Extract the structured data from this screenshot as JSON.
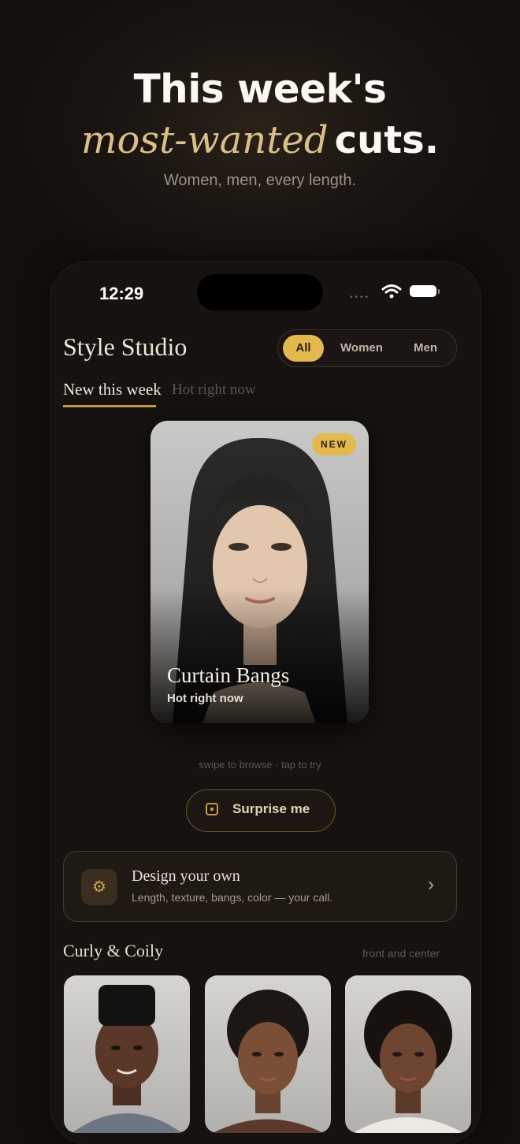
{
  "hero": {
    "line1": "This week's",
    "italic": "most-wanted",
    "bold": "cuts.",
    "subtitle": "Women, men, every length."
  },
  "status_bar": {
    "time": "12:29"
  },
  "header": {
    "title": "Style Studio",
    "filters": [
      "All",
      "Women",
      "Men"
    ],
    "active_filter": "All"
  },
  "tabs": {
    "active": "New this week",
    "inactive": "Hot right now"
  },
  "featured": {
    "badge": "NEW",
    "name": "Curtain Bangs",
    "subtitle": "Hot right now"
  },
  "hint": "swipe to browse · tap to try",
  "surprise_button": "Surprise me",
  "design_card": {
    "title": "Design your own",
    "subtitle": "Length, texture, bangs, color — your call."
  },
  "section": {
    "title": "Curly & Coily",
    "meta": "front and center"
  },
  "colors": {
    "accent": "#e3b94e",
    "background": "#120f0d",
    "italic_gold": "#d9c08a"
  }
}
